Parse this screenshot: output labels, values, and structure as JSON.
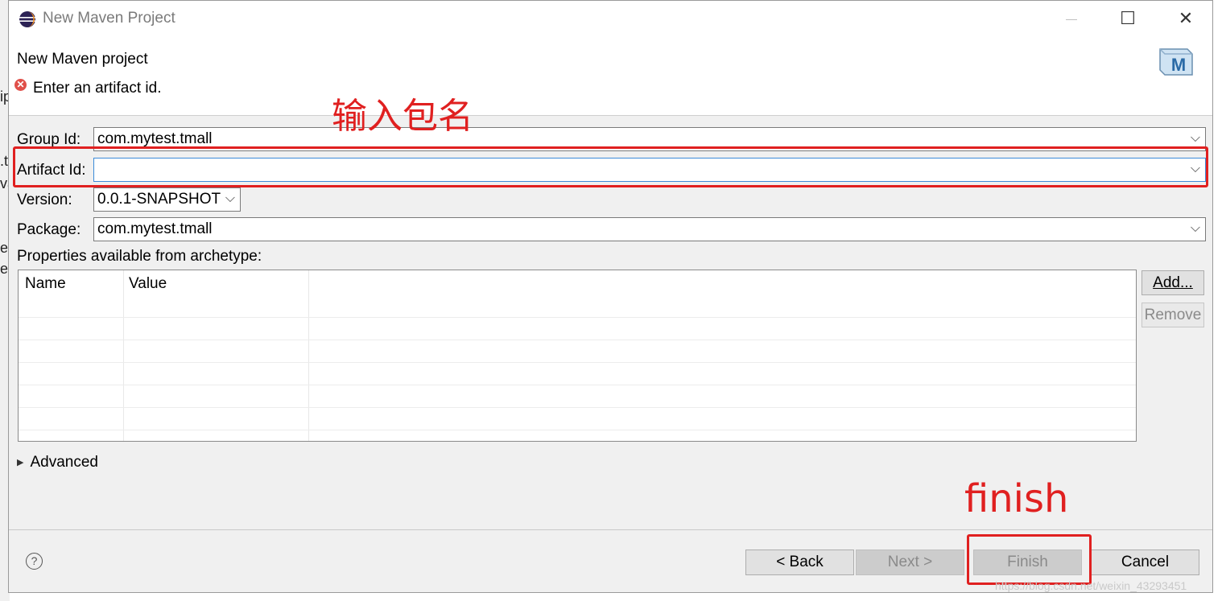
{
  "window": {
    "title": "New Maven Project",
    "minimize": "—",
    "maximize": "☐",
    "close": "✕"
  },
  "header": {
    "title": "New Maven project",
    "message": "Enter an artifact id.",
    "error_glyph": "✕",
    "logo_letter": "M"
  },
  "background_fragments": [
    "ip",
    ".t",
    "va",
    "es",
    "es"
  ],
  "fields": {
    "group_id": {
      "label": "Group Id:",
      "value": "com.mytest.tmall"
    },
    "artifact_id": {
      "label": "Artifact Id:",
      "value": ""
    },
    "version": {
      "label": "Version:",
      "value": "0.0.1-SNAPSHOT"
    },
    "package": {
      "label": "Package:",
      "value": "com.mytest.tmall"
    }
  },
  "properties": {
    "label": "Properties available from archetype:",
    "columns": [
      "Name",
      "Value"
    ],
    "rows": []
  },
  "side_buttons": {
    "add": "Add...",
    "remove": "Remove"
  },
  "advanced": {
    "label": "Advanced"
  },
  "footer": {
    "help": "?",
    "back": "< Back",
    "next": "Next >",
    "finish": "Finish",
    "cancel": "Cancel"
  },
  "annotations": {
    "artifact_note": "输入包名",
    "finish_note": "finish",
    "color": "#e02020"
  },
  "watermark": "https://blog.csdn.net/weixin_43293451"
}
